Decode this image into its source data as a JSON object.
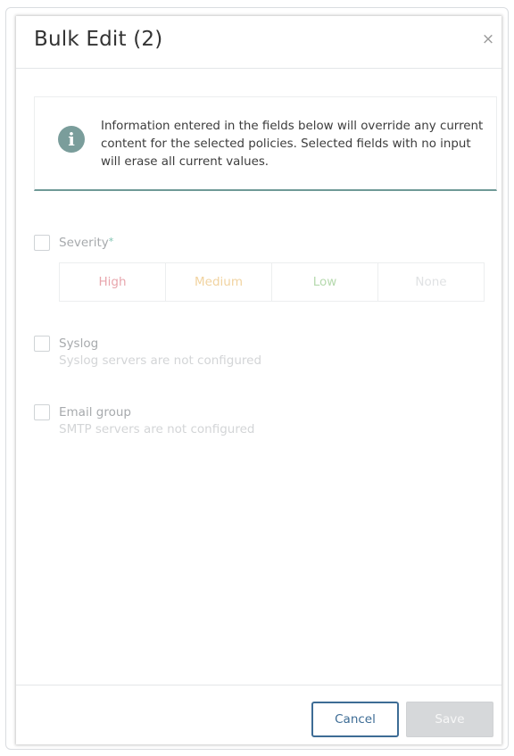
{
  "dialog": {
    "title": "Bulk Edit (2)",
    "close_icon": "close-icon",
    "close_glyph": "×"
  },
  "info": {
    "icon": "info-icon",
    "icon_glyph": "i",
    "text": "Information entered in the fields below will override any current content for the selected policies. Selected fields with no input will erase all current values."
  },
  "fields": {
    "severity": {
      "label": "Severity",
      "required_mark": "*",
      "checked": false,
      "options": [
        {
          "label": "High",
          "color": "#e8a6ad"
        },
        {
          "label": "Medium",
          "color": "#f1d3a0"
        },
        {
          "label": "Low",
          "color": "#b6d9ae"
        },
        {
          "label": "None",
          "color": "#e0e2e4"
        }
      ]
    },
    "syslog": {
      "label": "Syslog",
      "hint": "Syslog servers are not configured",
      "checked": false
    },
    "email_group": {
      "label": "Email group",
      "hint": "SMTP servers are not configured",
      "checked": false
    }
  },
  "footer": {
    "cancel_label": "Cancel",
    "save_label": "Save"
  },
  "colors": {
    "accent": "#3d6c95",
    "info_rule": "#6f9a97",
    "info_icon_bg": "#7a9d9b",
    "disabled_button": "#d6d8da"
  }
}
